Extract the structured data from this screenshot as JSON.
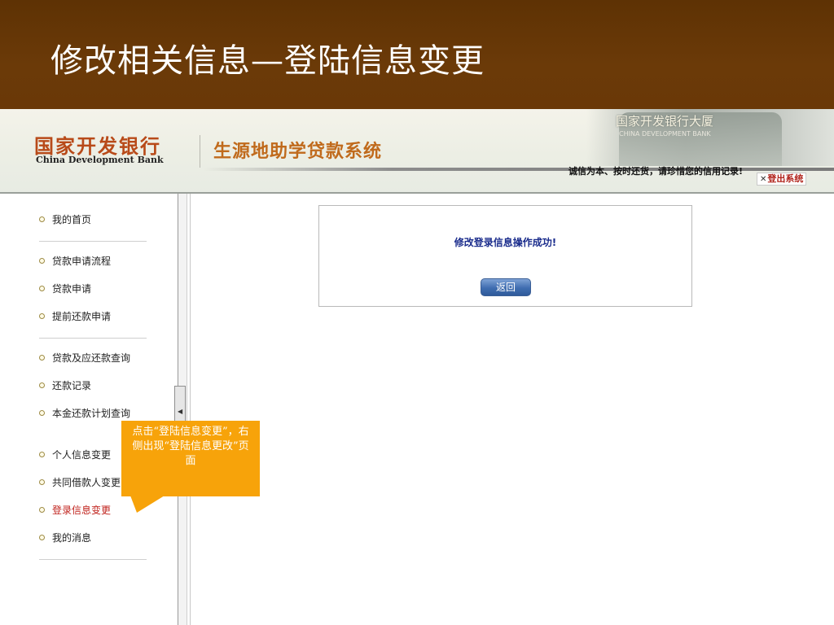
{
  "slide": {
    "title": "修改相关信息—登陆信息变更"
  },
  "banner": {
    "logo_cn": "国家开发银行",
    "logo_en": "China Development Bank",
    "system_name": "生源地助学贷款系统",
    "building_text": "国家开发银行大厦",
    "building_sub": "CHINA DEVELOPMENT BANK",
    "slogan": "诚信为本、按时还货，请珍惜您的信用记录!",
    "logout_label": "登出系统",
    "logout_icon": "close-icon"
  },
  "sidebar": {
    "items": [
      {
        "label": "我的首页"
      },
      {
        "label": "贷款申请流程"
      },
      {
        "label": "贷款申请"
      },
      {
        "label": "提前还款申请"
      },
      {
        "label": "贷款及应还款查询"
      },
      {
        "label": "还款记录"
      },
      {
        "label": "本金还款计划查询"
      },
      {
        "label": "个人信息变更"
      },
      {
        "label": "共同借款人变更"
      },
      {
        "label": "登录信息变更",
        "active": true
      },
      {
        "label": "我的消息"
      }
    ],
    "active_color": "#c0221c"
  },
  "main": {
    "message": "修改登录信息操作成功!",
    "back_label": "返回"
  },
  "callout": {
    "text": "点击“登陆信息变更”，右侧出现“登陆信息更改”页面"
  },
  "colors": {
    "header_bg": "#6b3a08",
    "callout_bg": "#f7a30a",
    "button_blue": "#3f6db0",
    "message_color": "#1a2c8c"
  }
}
